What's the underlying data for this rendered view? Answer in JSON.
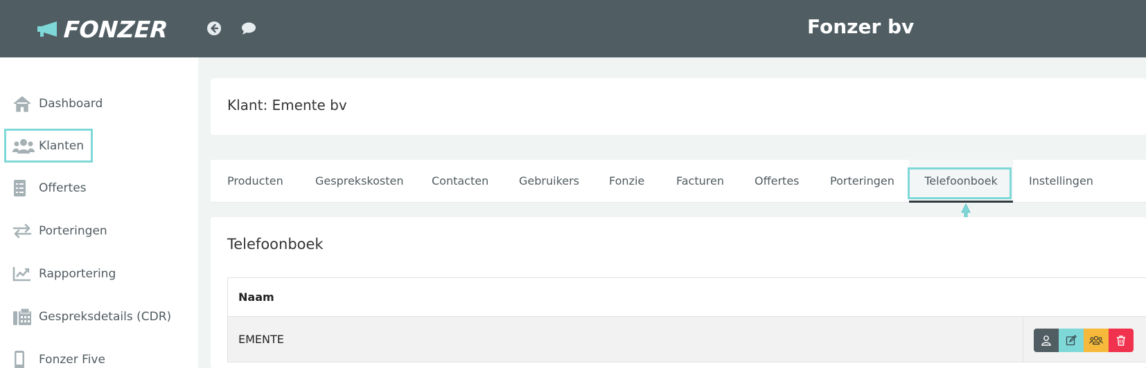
{
  "header": {
    "logo_text": "FONZER",
    "company": "Fonzer bv",
    "icons": [
      "arrow-left-circle-icon",
      "comment-icon"
    ]
  },
  "sidebar": {
    "items": [
      {
        "label": "Dashboard",
        "icon": "home-icon"
      },
      {
        "label": "Klanten",
        "icon": "users-icon",
        "highlighted": true
      },
      {
        "label": "Offertes",
        "icon": "list-icon"
      },
      {
        "label": "Porteringen",
        "icon": "exchange-icon"
      },
      {
        "label": "Rapportering",
        "icon": "chart-icon"
      },
      {
        "label": "Gespreksdetails (CDR)",
        "icon": "fax-icon"
      },
      {
        "label": "Fonzer Five",
        "icon": "mobile-icon"
      }
    ]
  },
  "client": {
    "title": "Klant: Emente bv"
  },
  "tabs": [
    {
      "label": "Producten"
    },
    {
      "label": "Gesprekskosten"
    },
    {
      "label": "Contacten"
    },
    {
      "label": "Gebruikers"
    },
    {
      "label": "Fonzie"
    },
    {
      "label": "Facturen"
    },
    {
      "label": "Offertes"
    },
    {
      "label": "Porteringen"
    },
    {
      "label": "Telefoonboek",
      "active": true
    },
    {
      "label": "Instellingen"
    }
  ],
  "section": {
    "title": "Telefoonboek"
  },
  "table": {
    "header": "Naam",
    "rows": [
      {
        "name": "EMENTE"
      }
    ]
  },
  "actions": [
    {
      "icon": "user-icon",
      "color": "#505e64"
    },
    {
      "icon": "edit-icon",
      "color": "#7fd8d8"
    },
    {
      "icon": "group-icon",
      "color": "#f6b93b"
    },
    {
      "icon": "trash-icon",
      "color": "#f0324f"
    }
  ],
  "colors": {
    "topbar": "#505e64",
    "highlight": "#7fd8d8",
    "background": "#f0f5f4"
  }
}
